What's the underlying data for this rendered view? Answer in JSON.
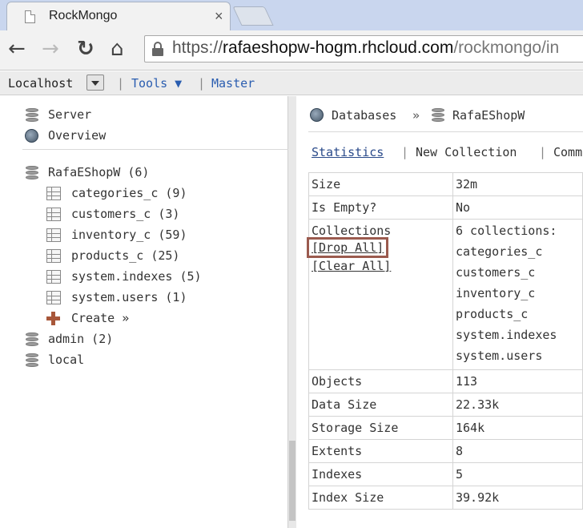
{
  "browser": {
    "tab_title": "RockMongo",
    "close_glyph": "×",
    "url_scheme": "https://",
    "url_host": "rafaeshopw-hogm.rhcloud.com",
    "url_path": "/rockmongo/in"
  },
  "topbar": {
    "host": "Localhost",
    "tools": "Tools ▼",
    "master": "Master",
    "sep": "|"
  },
  "sidebar": {
    "server": "Server",
    "overview": "Overview",
    "db_active": "RafaEShopW (6)",
    "collections": [
      "categories_c (9)",
      "customers_c (3)",
      "inventory_c (59)",
      "products_c (25)",
      "system.indexes (5)",
      "system.users (1)"
    ],
    "create": "Create »",
    "other_dbs": [
      "admin (2)",
      "local"
    ]
  },
  "main": {
    "breadcrumb_db": "Databases",
    "breadcrumb_arrow": "»",
    "breadcrumb_current": "RafaEShopW",
    "ops": [
      "Statistics",
      "New Collection",
      "Comm"
    ],
    "op_sep": "|",
    "stats": {
      "size_k": "Size",
      "size_v": "32m",
      "empty_k": "Is Empty?",
      "empty_v": "No",
      "coll_k": "Collections",
      "drop_all": "[Drop All]",
      "clear_all": "[Clear All]",
      "coll_count": "6 collections:",
      "coll_names": [
        "categories_c",
        "customers_c",
        "inventory_c",
        "products_c",
        "system.indexes",
        "system.users"
      ],
      "objects_k": "Objects",
      "objects_v": "113",
      "datasize_k": "Data Size",
      "datasize_v": "22.33k",
      "storage_k": "Storage Size",
      "storage_v": "164k",
      "extents_k": "Extents",
      "extents_v": "8",
      "indexes_k": "Indexes",
      "indexes_v": "5",
      "indexsize_k": "Index Size",
      "indexsize_v": "39.92k"
    }
  }
}
